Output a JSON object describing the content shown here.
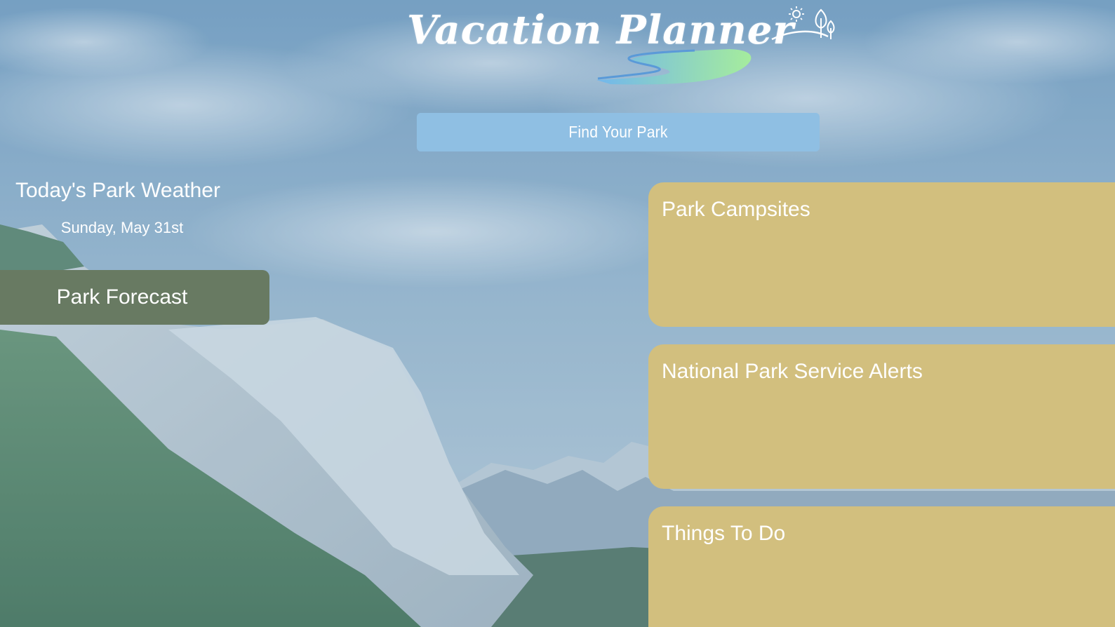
{
  "header": {
    "logo_text": "Vacation Planner",
    "logo_icon": "sun-trees-river-logo"
  },
  "search": {
    "find_park_label": "Find Your Park"
  },
  "weather": {
    "title": "Today's Park Weather",
    "date": "Sunday, May 31st",
    "forecast_label": "Park Forecast"
  },
  "panels": [
    {
      "title": "Park Campsites"
    },
    {
      "title": "National Park Service Alerts"
    },
    {
      "title": "Things To Do"
    }
  ],
  "colors": {
    "find_button": "#8fbfe3",
    "forecast_button": "#687a62",
    "panel": "#d2bf7e",
    "text": "#ffffff"
  },
  "background": {
    "scene": "mountain-valley-photo"
  }
}
